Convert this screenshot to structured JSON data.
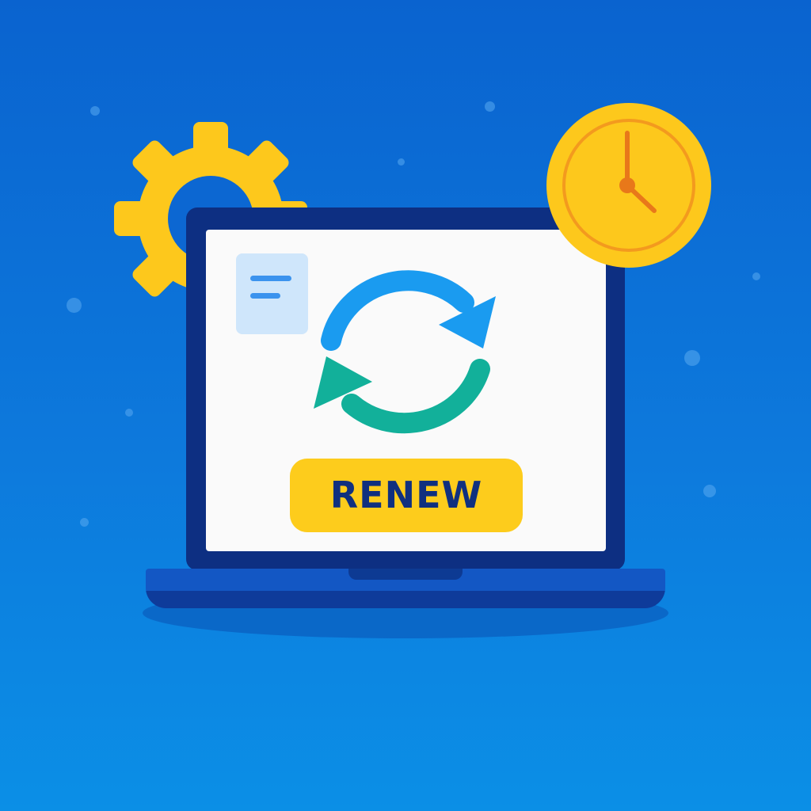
{
  "scene": {
    "background_top": "#0a63cf",
    "background_bottom": "#0b8fe6"
  },
  "decorations": {
    "gear": {
      "icon": "gear-icon",
      "color": "#fdc81c"
    },
    "clock": {
      "icon": "clock-icon",
      "face_color": "#fdc81c",
      "ring_color": "#f39a1e",
      "hands_color": "#e8781a"
    },
    "refresh": {
      "icon": "refresh-icon",
      "top_arrow_color": "#1a9bf0",
      "bottom_arrow_color": "#12b09a"
    },
    "document": {
      "icon": "document-icon",
      "card_color": "#cfe6fb",
      "line_color": "#3b93ee"
    }
  },
  "laptop": {
    "frame_color": "#0d2f82",
    "screen_color": "#fafafa",
    "base_color": "#1357c4"
  },
  "renew_button": {
    "label": "RENEW",
    "background": "#fdcc1c",
    "text_color": "#10307f"
  }
}
